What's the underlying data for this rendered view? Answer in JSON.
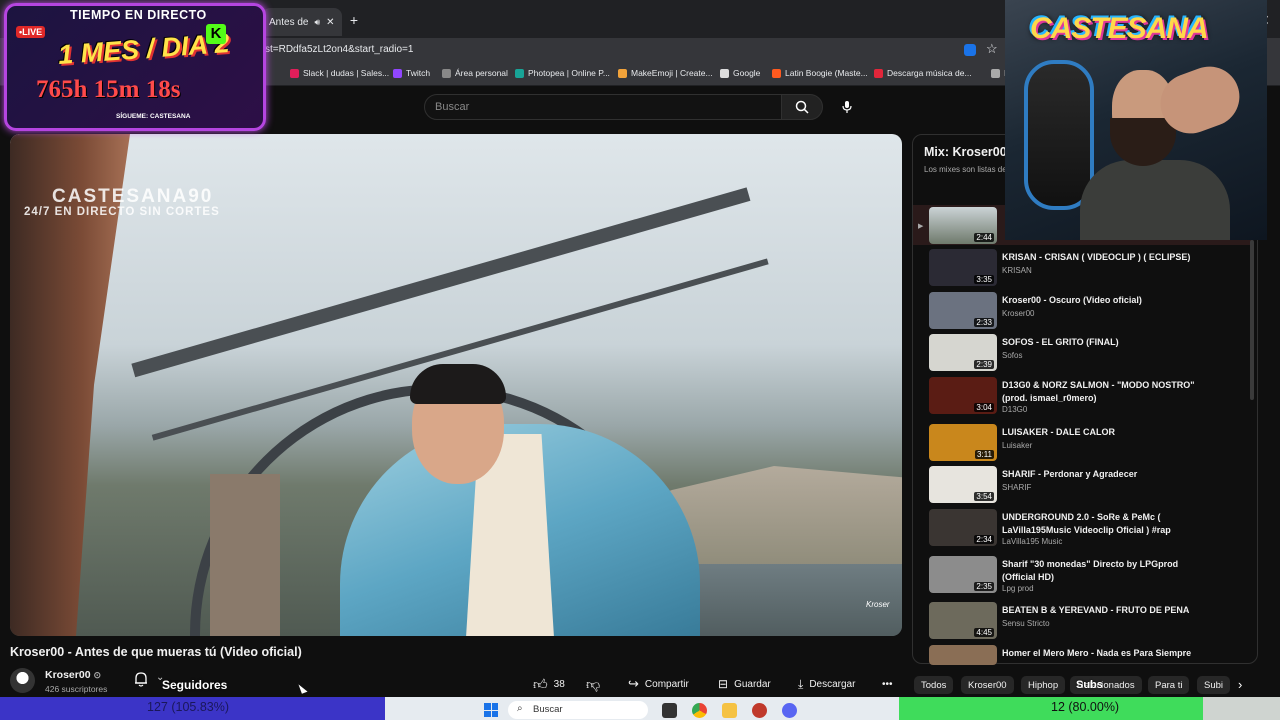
{
  "browser": {
    "tab_title": "Antes de",
    "url": "st=RDdfa5zLt2on4&start_radio=1",
    "bookmarks": [
      "Slack | dudas | Sales...",
      "Twitch",
      "Área personal",
      "Photopea | Online P...",
      "MakeEmoji | Create...",
      "Google",
      "Latin Boogie (Maste...",
      "Descarga música de...",
      "Imag"
    ],
    "bookmark_colors": [
      "#e01e5a",
      "#9146ff",
      "#888888",
      "#18a497",
      "#f2a33a",
      "#dddddd",
      "#ff5a1f",
      "#e2263a",
      "#aaaaaa"
    ]
  },
  "search": {
    "placeholder": "Buscar"
  },
  "video": {
    "watermark_title": "CASTESANA90",
    "watermark_sub": "24/7 EN DIRECTO SIN CORTES",
    "corner_mark": "Kroser",
    "title": "Kroser00 - Antes de que mueras tú (Video oficial)",
    "channel": "Kroser00",
    "subscribers": "426 suscriptores",
    "likes": "38",
    "share_label": "Compartir",
    "save_label": "Guardar",
    "download_label": "Descargar"
  },
  "overlay_follow_text": "Seguidores",
  "playlist": {
    "title": "Mix: Kroser00",
    "subtitle": "Los mixes son listas de",
    "current_duration": "2:44",
    "items": [
      {
        "title": "KRISAN - CRISAN ( VIDEOCLIP ) ( ECLIPSE)",
        "channel": "KRISAN",
        "duration": "3:35",
        "thumb": "#2b2a34"
      },
      {
        "title": "Kroser00 - Oscuro (Video oficial)",
        "channel": "Kroser00",
        "duration": "2:33",
        "thumb": "#6b7280"
      },
      {
        "title": "SOFOS - EL GRITO (FINAL)",
        "channel": "Sofos",
        "duration": "2:39",
        "thumb": "#d6d6d0"
      },
      {
        "title": "D13G0 & NORZ SALMON - \"MODO NOSTRO\" (prod. ismael_r0mero)",
        "channel": "D13G0",
        "duration": "3:04",
        "thumb": "#5a1c14"
      },
      {
        "title": "LUISAKER - DALE CALOR",
        "channel": "Luisaker",
        "duration": "3:11",
        "thumb": "#c9871c"
      },
      {
        "title": "SHARIF - Perdonar y Agradecer",
        "channel": "SHARIF",
        "duration": "3:54",
        "thumb": "#e7e4de"
      },
      {
        "title": "UNDERGROUND 2.0 - SoRe & PeMc ( LaVilla195Music Videoclip Oficial ) #rap",
        "channel": "LaVilla195 Music",
        "duration": "2:34",
        "thumb": "#3a3532"
      },
      {
        "title": "Sharif \"30 monedas\" Directo by LPGprod (Official HD)",
        "channel": "Lpg prod",
        "duration": "2:35",
        "thumb": "#8c8c8c"
      },
      {
        "title": "BEATEN B & YEREVAND - FRUTO DE PENA",
        "channel": "Sensu Stricto",
        "duration": "4:45",
        "thumb": "#6d6a5c"
      },
      {
        "title": "Homer el Mero Mero - Nada es Para Siempre",
        "channel": "",
        "duration": "",
        "thumb": "#8a6e55"
      }
    ]
  },
  "chips": [
    "Todos",
    "Kroser00",
    "Hiphop",
    "Relacionados",
    "Para ti",
    "Subi"
  ],
  "stream_overlay": {
    "heading": "TIEMPO EN DIRECTO",
    "live_badge": "LIVE",
    "month_day": "1 MES / DIA 2",
    "timer": "765h 15m 18s",
    "follow": "SÍGUEME: CASTESANA",
    "kick_letter": "K",
    "cam_logo": "CASTESANA",
    "subs_label": "Subs"
  },
  "goals": {
    "left_text": "127 (105.83%)",
    "right_text": "12 (80.00%)"
  },
  "taskbar": {
    "search_label": "Buscar"
  }
}
